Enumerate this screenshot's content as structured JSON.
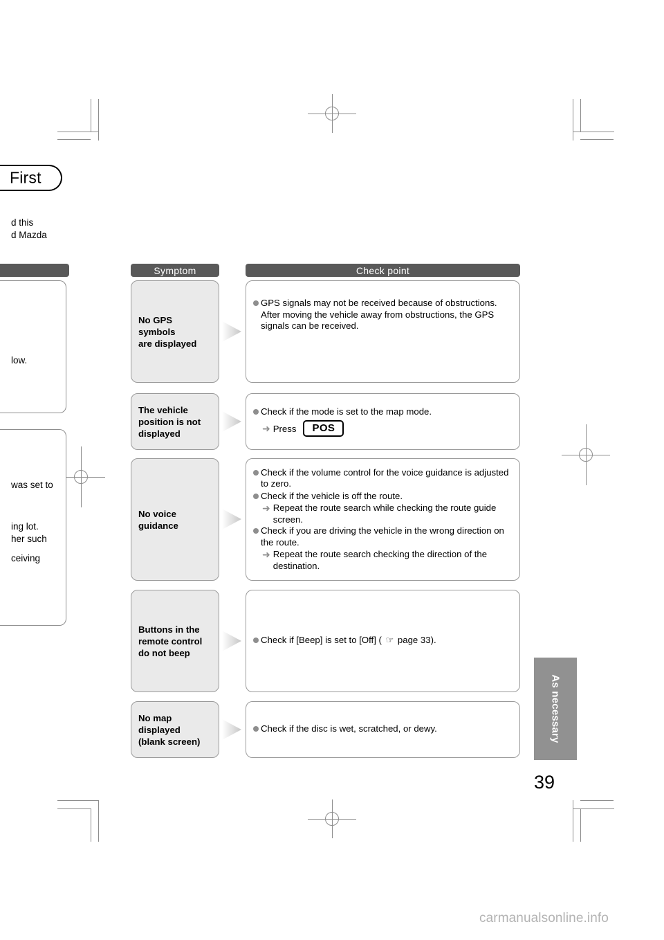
{
  "page": {
    "chapter_tab": "First",
    "page_number": "39",
    "side_tab": "As necessary",
    "watermark": "carmanualsonline.info"
  },
  "cut_text": {
    "intro_line1": "d this",
    "intro_line2": "d Mazda",
    "box1_fragment": "low.",
    "box2_fragment1": "was set to",
    "box2_fragment2": "ing lot.",
    "box2_fragment3": "her such",
    "box2_fragment4": "ceiving"
  },
  "columns": {
    "left_header": "",
    "symptom_header": "Symptom",
    "checkpoint_header": "Check point"
  },
  "icons": {
    "bullet": "filled-circle-bullet",
    "sub_arrow": "➜",
    "pointing_hand": "☞",
    "flow_arrow": "right-triangle-arrow"
  },
  "rows": [
    {
      "symptom": "No GPS symbols\nare displayed",
      "checks": [
        {
          "type": "bullet",
          "text": "GPS signals may not be received because of obstructions. After moving the vehicle away from obstructions, the GPS signals can be received."
        }
      ]
    },
    {
      "symptom": "The vehicle\nposition is not\ndisplayed",
      "checks": [
        {
          "type": "bullet",
          "text": "Check if the mode is set to the map mode."
        },
        {
          "type": "press",
          "label": "Press",
          "button": "POS"
        }
      ]
    },
    {
      "symptom": "No voice guidance",
      "checks": [
        {
          "type": "bullet",
          "text": "Check if the volume control for the voice guidance is adjusted to zero."
        },
        {
          "type": "bullet",
          "text": "Check if the vehicle is off the route."
        },
        {
          "type": "sub",
          "text": "Repeat the route search while checking the route guide screen."
        },
        {
          "type": "bullet",
          "text": "Check if you are driving the vehicle in the wrong direction on the route."
        },
        {
          "type": "sub",
          "text": "Repeat the route search checking the direction of the destination."
        }
      ]
    },
    {
      "symptom": "Buttons in the\nremote control\ndo not beep",
      "checks": [
        {
          "type": "bullet_ref",
          "text_before": "Check if [Beep] is set to [Off] ( ",
          "ref": " page 33).",
          "hand": "☞"
        }
      ]
    },
    {
      "symptom": "No map displayed\n(blank screen)",
      "checks": [
        {
          "type": "bullet",
          "text": "Check if the disc is wet, scratched, or dewy."
        }
      ]
    }
  ],
  "colors": {
    "header_bar": "#595959",
    "symptom_fill": "#eaeaea",
    "box_border": "#9a9a9a",
    "side_tab": "#919191",
    "bullet": "#8e8e8e",
    "watermark": "#b3b3b3"
  }
}
